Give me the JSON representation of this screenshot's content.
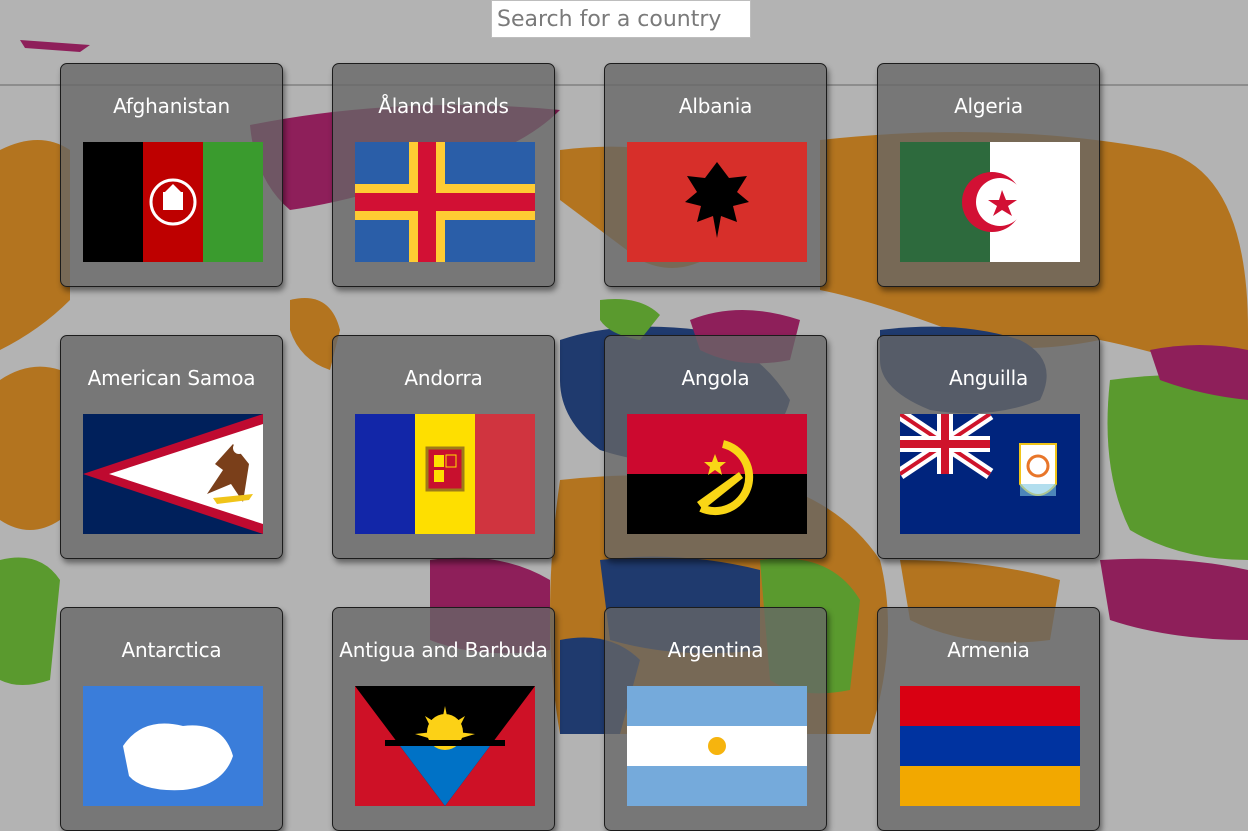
{
  "search": {
    "placeholder": "Search for a country",
    "value": ""
  },
  "countries": [
    {
      "name": "Afghanistan",
      "flag": "afghanistan-flag"
    },
    {
      "name": "Åland Islands",
      "flag": "aland-islands-flag"
    },
    {
      "name": "Albania",
      "flag": "albania-flag"
    },
    {
      "name": "Algeria",
      "flag": "algeria-flag"
    },
    {
      "name": "American Samoa",
      "flag": "american-samoa-flag"
    },
    {
      "name": "Andorra",
      "flag": "andorra-flag"
    },
    {
      "name": "Angola",
      "flag": "angola-flag"
    },
    {
      "name": "Anguilla",
      "flag": "anguilla-flag"
    },
    {
      "name": "Antarctica",
      "flag": "antarctica-flag"
    },
    {
      "name": "Antigua and Barbuda",
      "flag": "antigua-and-barbuda-flag"
    },
    {
      "name": "Argentina",
      "flag": "argentina-flag"
    },
    {
      "name": "Armenia",
      "flag": "armenia-flag"
    }
  ],
  "colors": {
    "background": "#b3b3b3",
    "card": "#666666",
    "map_orange": "#b3741f",
    "map_navy": "#1f3a6e",
    "map_magenta": "#8e1f5a",
    "map_green": "#5a9a2e"
  }
}
